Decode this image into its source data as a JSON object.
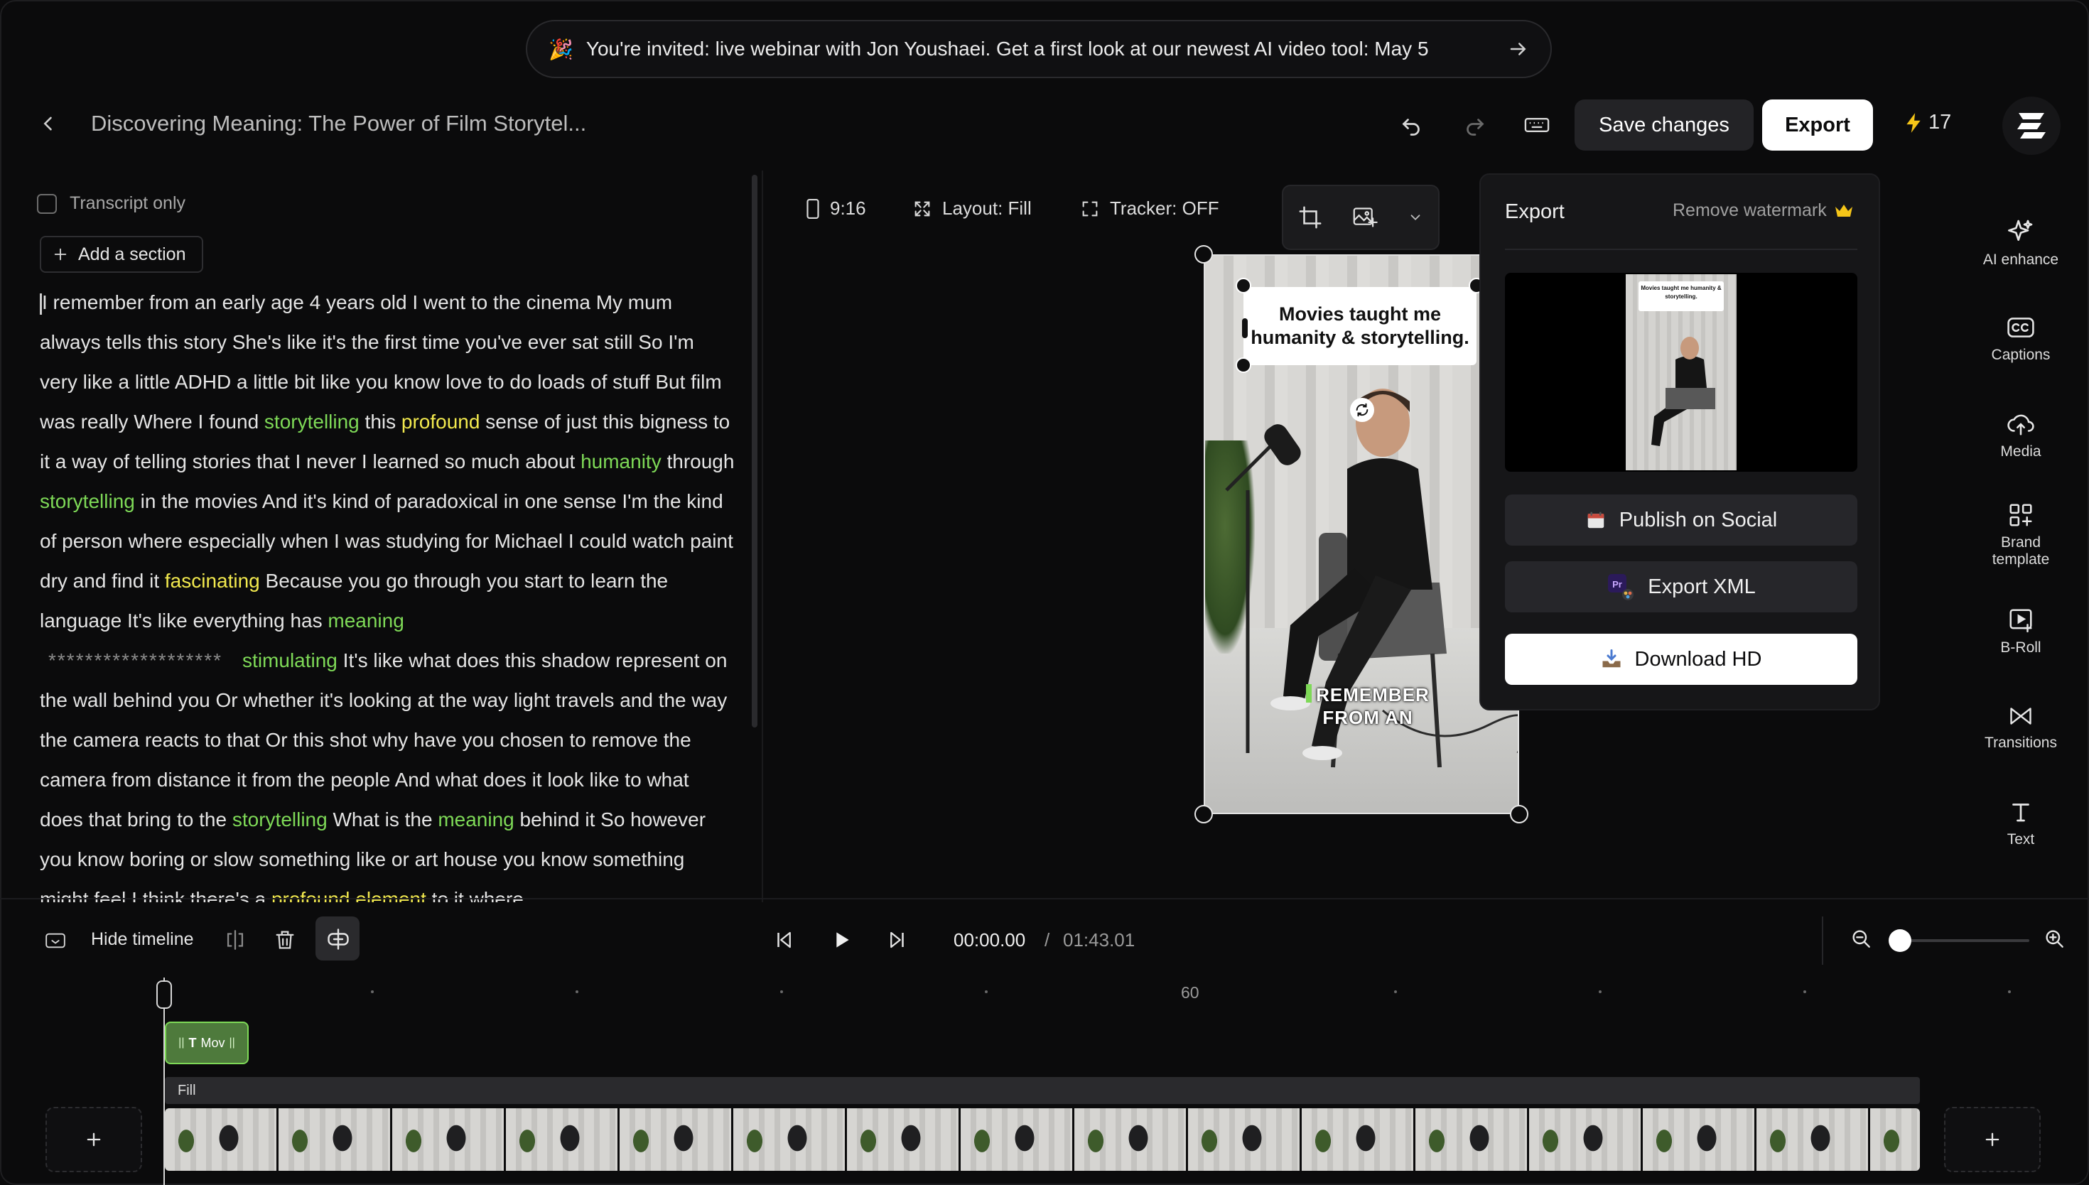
{
  "banner": {
    "emoji": "🎉",
    "text": "You're invited: live webinar with Jon Youshaei. Get a first look at our newest AI video tool: May 5"
  },
  "header": {
    "project_title": "Discovering Meaning: The Power of Film Storytel...",
    "save_label": "Save changes",
    "export_label": "Export",
    "credits": "17"
  },
  "transcript": {
    "transcript_only_label": "Transcript only",
    "add_section_label": "Add a section",
    "segments": [
      {
        "t": "I remember from an early age 4 years old I went to the cinema My mum always tells this story She's like it's the first time you've ever sat still So I'm very like a little ADHD a little bit like you know love to do loads of stuff But film was really Where I found ",
        "c": ""
      },
      {
        "t": "storytelling",
        "c": "g"
      },
      {
        "t": " this ",
        "c": ""
      },
      {
        "t": "profound",
        "c": "y"
      },
      {
        "t": " sense of just this bigness to it a way of telling stories that I never I learned so much about ",
        "c": ""
      },
      {
        "t": "humanity",
        "c": "g"
      },
      {
        "t": " through ",
        "c": ""
      },
      {
        "t": "storytelling",
        "c": "g"
      },
      {
        "t": " in the movies And it's kind of paradoxical in one sense I'm the kind of person where especially when I was studying for Michael I could watch paint dry and find it ",
        "c": ""
      },
      {
        "t": "fascinating",
        "c": "y"
      },
      {
        "t": " Because you go through you start to learn the language It's like everything has ",
        "c": ""
      },
      {
        "t": "meaning",
        "c": "g"
      },
      {
        "t": "\n",
        "c": "br"
      },
      {
        "t": "*******************",
        "c": "stars"
      },
      {
        "t": "stimulating",
        "c": "g"
      },
      {
        "t": " It's like what does this shadow represent on the wall behind you Or whether it's looking at the way light travels and the way the camera reacts to that Or this shot why have you chosen to remove the camera from distance it from the people And what does it look like to what does that bring to the ",
        "c": ""
      },
      {
        "t": "storytelling",
        "c": "g"
      },
      {
        "t": " What is the ",
        "c": ""
      },
      {
        "t": "meaning",
        "c": "g"
      },
      {
        "t": " behind it So however you know boring or slow something like or art house you know something might feel I think there's a ",
        "c": ""
      },
      {
        "t": "profound element",
        "c": "y"
      },
      {
        "t": " to it where",
        "c": ""
      }
    ]
  },
  "preview_toolbar": {
    "aspect": "9:16",
    "layout": "Layout: Fill",
    "tracker": "Tracker: OFF"
  },
  "video": {
    "caption_box": "Movies taught me humanity & storytelling.",
    "caption_line1": "REMEMBER",
    "caption_line2": "FROM AN"
  },
  "export_panel": {
    "title": "Export",
    "remove_watermark": "Remove watermark",
    "publish_label": "Publish on Social",
    "export_xml_label": "Export XML",
    "download_label": "Download HD",
    "publish_icon": "calendar-icon",
    "xml_icon": "premiere-icon",
    "download_icon": "inbox-tray-icon"
  },
  "right_rail": [
    {
      "label": "AI enhance",
      "icon": "sparkle-icon"
    },
    {
      "label": "Captions",
      "icon": "cc-icon"
    },
    {
      "label": "Media",
      "icon": "cloud-upload-icon"
    },
    {
      "label": "Brand template",
      "icon": "grid-plus-icon"
    },
    {
      "label": "B-Roll",
      "icon": "video-add-icon"
    },
    {
      "label": "Transitions",
      "icon": "bowtie-icon"
    },
    {
      "label": "Text",
      "icon": "text-icon"
    }
  ],
  "timeline": {
    "hide_label": "Hide timeline",
    "time_current": "00:00.00",
    "time_sep": "/",
    "time_total": "01:43.01",
    "ruler_label": "60",
    "text_clip_label": "Mov",
    "fill_label": "Fill",
    "zoom_level": 0.05
  },
  "colors": {
    "accent_green": "#7ed957",
    "accent_yellow": "#f2e94e",
    "background": "#0b0b0c",
    "credits_bolt": "#f5c518",
    "crown": "#f5c518"
  }
}
